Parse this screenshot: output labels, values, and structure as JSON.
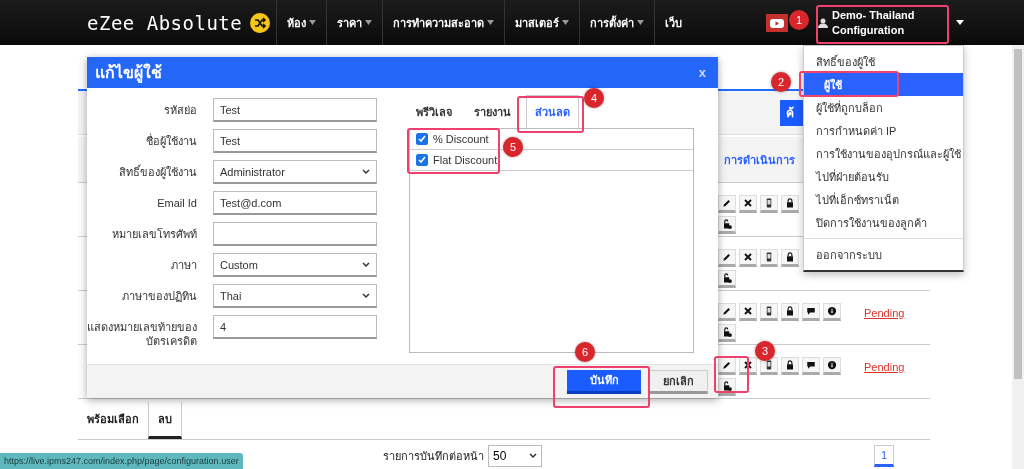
{
  "navbar": {
    "logo": "eZee Absolute",
    "menu": [
      {
        "label": "ห้อง",
        "has_caret": true
      },
      {
        "label": "ราคา",
        "has_caret": true
      },
      {
        "label": "การทำความสะอาด",
        "has_caret": true
      },
      {
        "label": "มาสเตอร์",
        "has_caret": true
      },
      {
        "label": "การตั้งค่า",
        "has_caret": true
      },
      {
        "label": "เว็บ",
        "has_caret": false
      }
    ],
    "user": "Demo- Thailand Configuration"
  },
  "page": {
    "search_button": "ค้",
    "actions_header": "การดำเนินการ",
    "rows": [
      {
        "kind": "covered"
      },
      {
        "kind": "covered"
      },
      {
        "kind": "full",
        "status": "Pending"
      },
      {
        "kind": "full",
        "status": "Pending"
      }
    ],
    "footer_tabs": [
      {
        "label": "พร้อมเลือก",
        "selected": false
      },
      {
        "label": "ลบ",
        "selected": true
      }
    ],
    "per_page_label": "รายการบันทึกต่อหน้า",
    "per_page": "50",
    "pages": [
      {
        "label": "1",
        "selected": true
      }
    ]
  },
  "dropdown": {
    "items": [
      {
        "label": "สิทธิ์ของผู้ใช้",
        "selected": false
      },
      {
        "label": "ผู้ใช้",
        "selected": true
      },
      {
        "label": "ผู้ใช้ที่ถูกบล็อก",
        "selected": false
      },
      {
        "label": "การกำหนดค่า IP",
        "selected": false
      },
      {
        "label": "การใช้งานของอุปกรณ์และผู้ใช้",
        "selected": false
      },
      {
        "label": "ไปที่ฝ่ายต้อนรับ",
        "selected": false
      },
      {
        "label": "ไปที่เอ็กซ์ทราเน็ต",
        "selected": false
      },
      {
        "label": "ปิดการใช้งานของลูกค้า",
        "selected": false
      }
    ],
    "logout": "ออกจากระบบ"
  },
  "modal": {
    "title": "แก้ไขผู้ใช้",
    "close": "x",
    "fields": [
      {
        "label": "รหัสย่อ",
        "kind": "text",
        "value": "Test"
      },
      {
        "label": "ชื่อผู้ใช้งาน",
        "kind": "text",
        "value": "Test"
      },
      {
        "label": "สิทธิ์ของผู้ใช้งาน",
        "kind": "select",
        "value": "Administrator"
      },
      {
        "label": "Email Id",
        "kind": "text",
        "value": "Test@d.com"
      },
      {
        "label": "หมายเลขโทรศัพท์",
        "kind": "text"
      },
      {
        "label": "ภาษา",
        "kind": "select",
        "value": "Custom"
      },
      {
        "label": "ภาษาของปฏิทิน",
        "kind": "select",
        "value": "Thai"
      },
      {
        "label": "แสดงหมายเลขท้ายของบัตรเครดิต",
        "kind": "text",
        "value": "4"
      }
    ],
    "tabs": [
      {
        "label": "พรีวิเลจ",
        "selected": false
      },
      {
        "label": "รายงาน",
        "selected": false
      },
      {
        "label": "ส่วนลด",
        "selected": true
      }
    ],
    "permissions": [
      {
        "label": "% Discount",
        "checked": true
      },
      {
        "label": "Flat Discount",
        "checked": true
      }
    ],
    "buttons": [
      {
        "label": "บันทึก",
        "kind": "primary"
      },
      {
        "label": "ยกเลิก",
        "kind": "secondary"
      }
    ]
  },
  "callouts": [
    {
      "number": "1"
    },
    {
      "number": "2"
    },
    {
      "number": "3"
    },
    {
      "number": "4"
    },
    {
      "number": "5"
    },
    {
      "number": "6"
    }
  ],
  "status_url": "https://live.ipms247.com/index.php/page/configuration.user"
}
